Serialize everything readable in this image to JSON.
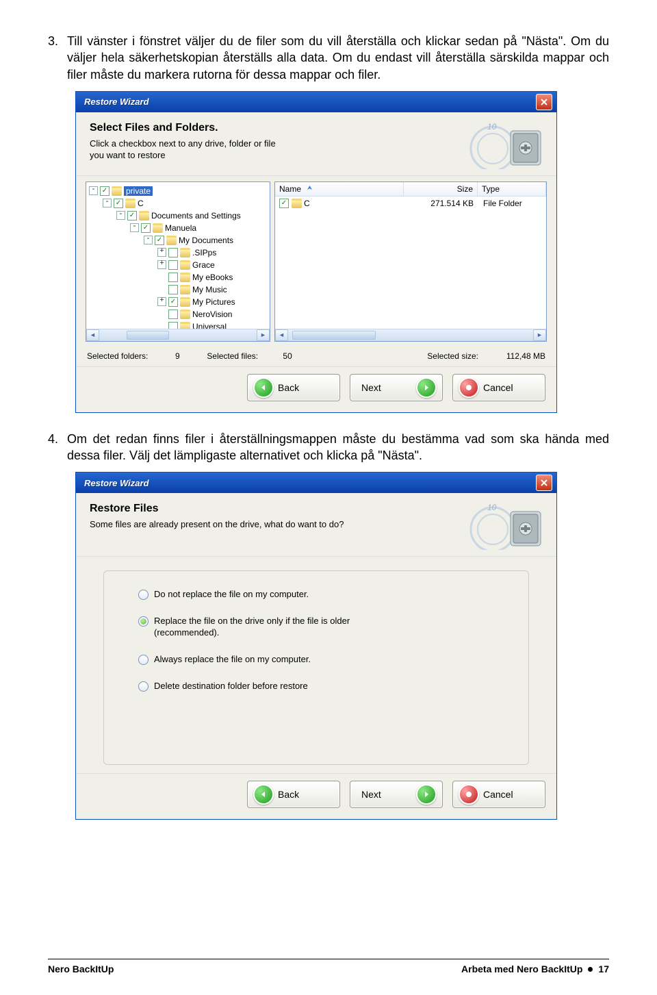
{
  "step3": {
    "num": "3.",
    "text": "Till vänster i fönstret väljer du de filer som du vill återställa och klickar sedan på \"Nästa\". Om du väljer hela säkerhetskopian återställs alla data. Om du endast vill återställa särskilda mappar och filer måste du markera rutorna för dessa mappar och filer."
  },
  "step4": {
    "num": "4.",
    "text": "Om det redan finns filer i återställningsmappen måste du bestämma vad som ska hända med dessa filer.  Välj det lämpligaste alternativet och klicka på \"Nästa\"."
  },
  "dialog1": {
    "title": "Restore Wizard",
    "heading": "Select Files and Folders.",
    "sub1": "Click a checkbox next to any drive, folder or file",
    "sub2": "you want to restore",
    "tree": [
      "private",
      "C",
      "Documents and Settings",
      "Manuela",
      "My Documents",
      ".SIPps",
      "Grace",
      "My eBooks",
      "My Music",
      "My Pictures",
      "NeroVision",
      "Universal"
    ],
    "cols": {
      "name": "Name",
      "size": "Size",
      "type": "Type"
    },
    "list": [
      {
        "name": "C",
        "size": "271.514 KB",
        "type": "File Folder"
      }
    ],
    "stats": {
      "folders_lbl": "Selected folders:",
      "folders_val": "9",
      "files_lbl": "Selected files:",
      "files_val": "50",
      "size_lbl": "Selected size:",
      "size_val": "112,48 MB"
    }
  },
  "dialog2": {
    "title": "Restore Wizard",
    "heading": "Restore Files",
    "sub": "Some files are already present on the drive, what do want to do?",
    "opts": [
      "Do not replace the file on my computer.",
      "Replace the file on the drive only if the file is older (recommended).",
      "Always replace the file on my computer.",
      "Delete destination folder before restore"
    ]
  },
  "buttons": {
    "back": "Back",
    "next": "Next",
    "cancel": "Cancel"
  },
  "footer": {
    "left": "Nero BackItUp",
    "right_text": "Arbeta med Nero BackItUp",
    "page": "17"
  }
}
